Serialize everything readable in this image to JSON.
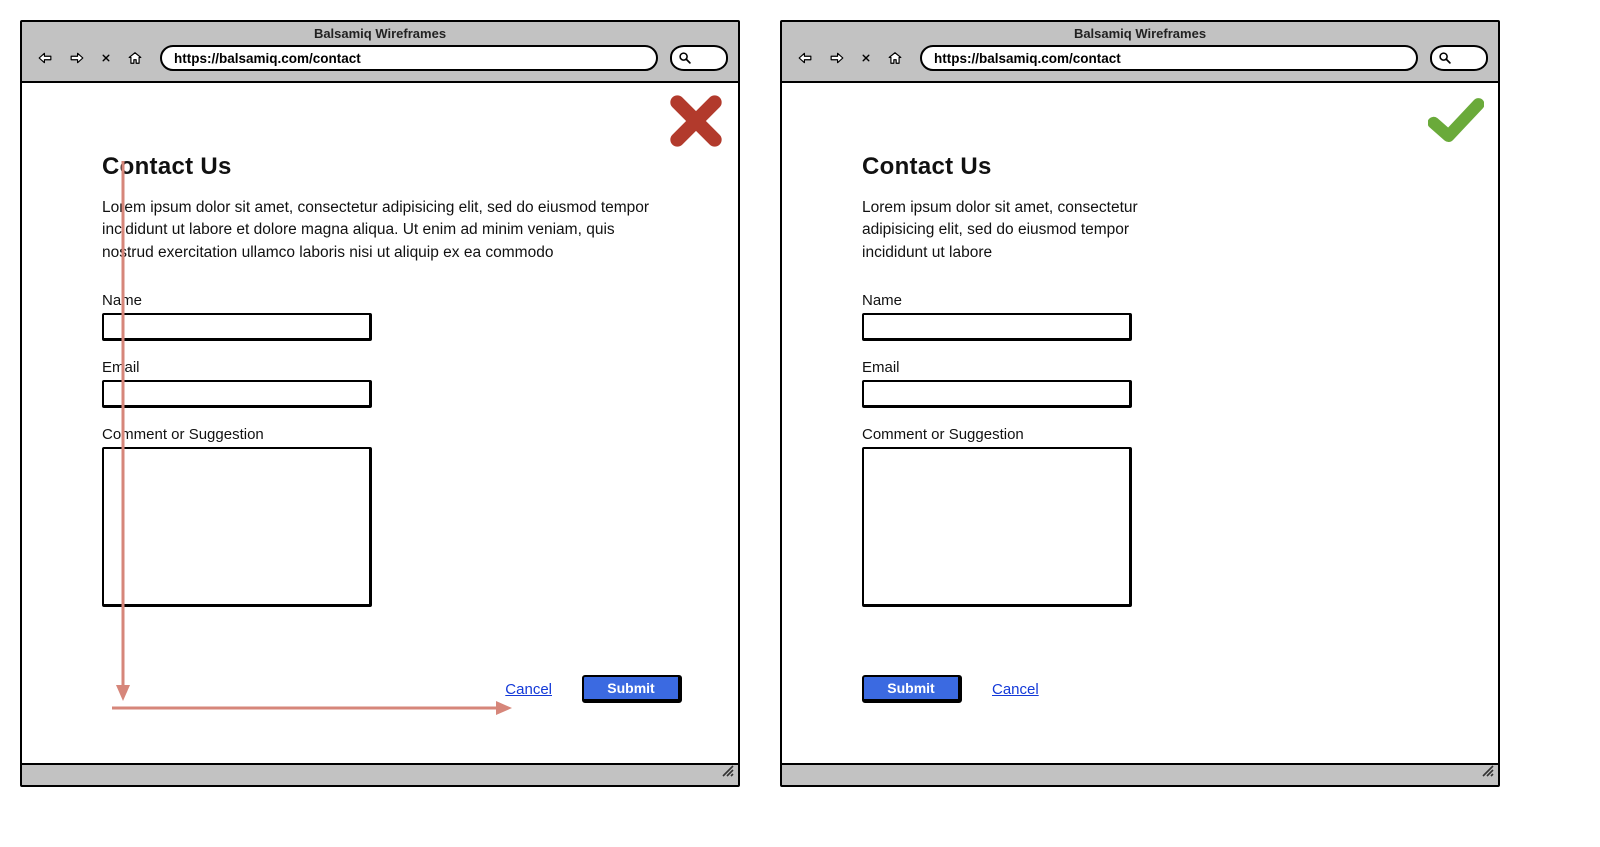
{
  "appTitle": "Balsamiq Wireframes",
  "url": "https://balsamiq.com/contact",
  "bad": {
    "heading": "Contact Us",
    "intro": "Lorem ipsum dolor sit amet, consectetur adipisicing elit, sed do eiusmod tempor incididunt ut labore et dolore magna aliqua. Ut enim ad minim veniam, quis nostrud exercitation ullamco laboris nisi ut aliquip ex ea commodo",
    "name_label": "Name",
    "email_label": "Email",
    "comment_label": "Comment or Suggestion",
    "cancel": "Cancel",
    "submit": "Submit"
  },
  "good": {
    "heading": "Contact Us",
    "intro": "Lorem ipsum dolor sit amet, consectetur adipisicing elit, sed do eiusmod tempor incididunt ut labore",
    "name_label": "Name",
    "email_label": "Email",
    "comment_label": "Comment or Suggestion",
    "submit": "Submit",
    "cancel": "Cancel"
  }
}
